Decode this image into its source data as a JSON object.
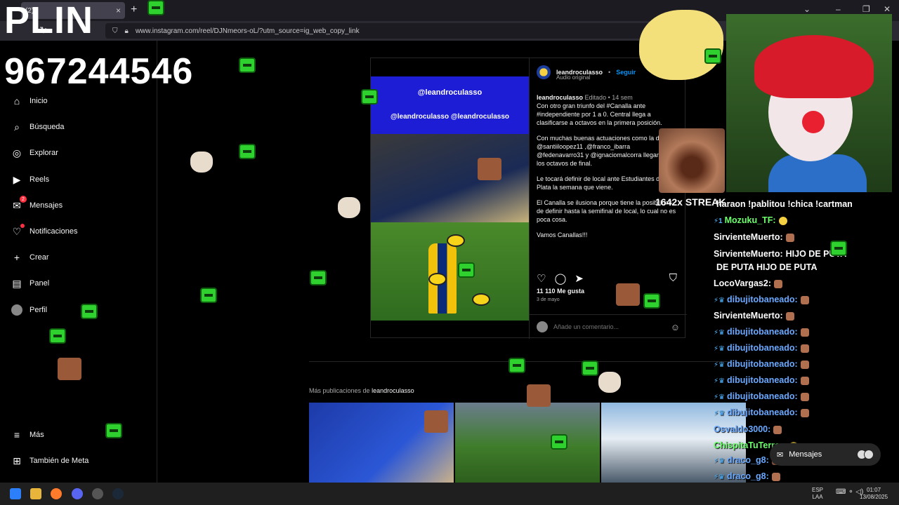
{
  "browser": {
    "tab_title": "(2)",
    "tab_close": "×",
    "new_tab": "+",
    "url": "www.instagram.com/reel/DJNmeors-oL/?utm_source=ig_web_copy_link",
    "window_controls": [
      "⌄",
      "–",
      "❐",
      "✕"
    ]
  },
  "overlay": {
    "plin": "PLIN",
    "phone": "967244546",
    "streak": "1642x STREAK"
  },
  "sidebar": {
    "items": [
      {
        "label": "Inicio",
        "icon": "home-icon",
        "glyph": "⌂"
      },
      {
        "label": "Búsqueda",
        "icon": "search-icon",
        "glyph": "⌕"
      },
      {
        "label": "Explorar",
        "icon": "compass-icon",
        "glyph": "◎"
      },
      {
        "label": "Reels",
        "icon": "reels-icon",
        "glyph": "▶"
      },
      {
        "label": "Mensajes",
        "icon": "messenger-icon",
        "glyph": "✉",
        "badge": "2"
      },
      {
        "label": "Notificaciones",
        "icon": "heart-icon",
        "glyph": "♡"
      },
      {
        "label": "Crear",
        "icon": "plus-icon",
        "glyph": "+"
      },
      {
        "label": "Panel",
        "icon": "dashboard-icon",
        "glyph": "▤"
      },
      {
        "label": "Perfil",
        "icon": "avatar",
        "glyph": ""
      }
    ],
    "more": {
      "label": "Más",
      "glyph": "≡"
    },
    "meta": {
      "label": "También de Meta",
      "glyph": "⊞"
    }
  },
  "post": {
    "media_handles": [
      "@leandroculasso",
      "@leandroculasso",
      "@leandroculasso"
    ],
    "user": "leandroculasso",
    "follow": "Seguir",
    "audio": "Audio original",
    "caption_user": "leandroculasso",
    "caption_meta": "Editado • 14 sem",
    "caption": [
      "Con otro gran triunfo del #Canalla ante #independiente por 1 a 0. Central llega a clasificarse a octavos  en la primera posición.",
      "Con muchas buenas actuaciones como la de @santiiloopez11 ,@franco_ibarra @fedenavarro31 y @ignaciomalcorra llegamos a los  octavos de final.",
      "Le tocará definir de local ante Estudiantes de la Plata la semana que viene.",
      "El Canalla se ilusiona porque tiene la posibilidad de definir hasta la semifinal de local, lo cual no es poca cosa.",
      "Vamos Canallas!!!"
    ],
    "likes": "11 110 Me gusta",
    "date": "3 de mayo",
    "comment_placeholder": "Añade un comentario...",
    "more_from_prefix": "Más publicaciones de",
    "more_from_user": "leandroculasso"
  },
  "chat": {
    "lines": [
      {
        "badges": "",
        "user": "",
        "text": "haraon !pablitou !chica !cartman",
        "style": ""
      },
      {
        "badges": "⚡1",
        "user": "Mozuku_TF:",
        "text": "",
        "style": "green",
        "emote": "y"
      },
      {
        "badges": "",
        "user": "SirvienteMuerto:",
        "text": "",
        "style": "",
        "emote": "f"
      },
      {
        "badges": "",
        "user": "SirvienteMuerto:",
        "text": "HIJO DE PUTA",
        "style": ""
      },
      {
        "badges": "",
        "user": "",
        "text": "DE PUTA  HIJO DE PUTA",
        "style": ""
      },
      {
        "badges": "",
        "user": "LocoVargas2:",
        "text": "",
        "style": "",
        "emote": "f"
      },
      {
        "badges": "⚡♛",
        "user": "dibujitobaneado:",
        "text": "",
        "style": "blue",
        "emote": "f"
      },
      {
        "badges": "",
        "user": "SirvienteMuerto:",
        "text": "",
        "style": "",
        "emote": "f"
      },
      {
        "badges": "⚡♛",
        "user": "dibujitobaneado:",
        "text": "",
        "style": "blue",
        "emote": "f"
      },
      {
        "badges": "⚡♛",
        "user": "dibujitobaneado:",
        "text": "",
        "style": "blue",
        "emote": "f"
      },
      {
        "badges": "⚡♛",
        "user": "dibujitobaneado:",
        "text": "",
        "style": "blue",
        "emote": "f"
      },
      {
        "badges": "⚡♛",
        "user": "dibujitobaneado:",
        "text": "",
        "style": "blue",
        "emote": "f"
      },
      {
        "badges": "⚡♛",
        "user": "dibujitobaneado:",
        "text": "",
        "style": "blue",
        "emote": "f"
      },
      {
        "badges": "⚡♛",
        "user": "dibujitobaneado:",
        "text": "",
        "style": "blue",
        "emote": "f"
      },
      {
        "badges": "",
        "user": "Osvaldo3000:",
        "text": "",
        "style": "blue",
        "emote": "f"
      },
      {
        "badges": "",
        "user": "ChispitaTuTerror:",
        "text": "",
        "style": "green",
        "emote": "y"
      },
      {
        "badges": "⚡♛",
        "user": "draco_g8:",
        "text": "",
        "style": "blue",
        "emote": "f"
      },
      {
        "badges": "⚡♛",
        "user": "draco_g8:",
        "text": "",
        "style": "blue",
        "emote": "f"
      },
      {
        "badges": "⚡♛",
        "user": "draco_g8:",
        "text": "",
        "style": "blue",
        "emote": "f"
      }
    ]
  },
  "messages_pill": {
    "label": "Mensajes"
  },
  "taskbar": {
    "lang": "ESP",
    "lang2": "LAA",
    "time": "01:07",
    "date": "13/08/2025"
  }
}
